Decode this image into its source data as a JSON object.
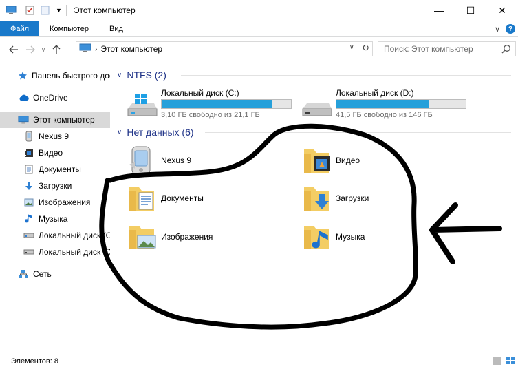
{
  "window": {
    "title": "Этот компьютер",
    "controls": {
      "minimize": "—",
      "maximize": "☐",
      "close": "✕"
    }
  },
  "ribbon": {
    "tabs": [
      "Файл",
      "Компьютер",
      "Вид"
    ],
    "expand": "∨",
    "help": "?"
  },
  "address": {
    "path": "Этот компьютер",
    "search_placeholder": "Поиск: Этот компьютер"
  },
  "sidebar": {
    "items": [
      {
        "label": "Панель быстрого доступа",
        "icon": "star-icon"
      },
      {
        "label": "OneDrive",
        "icon": "cloud-icon"
      },
      {
        "label": "Этот компьютер",
        "icon": "computer-icon"
      },
      {
        "label": "Nexus 9",
        "icon": "phone-icon"
      },
      {
        "label": "Видео",
        "icon": "video-icon"
      },
      {
        "label": "Документы",
        "icon": "documents-icon"
      },
      {
        "label": "Загрузки",
        "icon": "download-icon"
      },
      {
        "label": "Изображения",
        "icon": "pictures-icon"
      },
      {
        "label": "Музыка",
        "icon": "music-icon"
      },
      {
        "label": "Локальный диск (C:)",
        "icon": "drive-icon"
      },
      {
        "label": "Локальный диск (D:)",
        "icon": "drive-icon"
      },
      {
        "label": "Сеть",
        "icon": "network-icon"
      }
    ]
  },
  "groups": {
    "ntfs": {
      "label": "NTFS (2)",
      "drives": [
        {
          "name": "Локальный диск (C:)",
          "free": "3,10 ГБ свободно из 21,1 ГБ",
          "used_fraction": 0.853
        },
        {
          "name": "Локальный диск (D:)",
          "free": "41,5 ГБ свободно из 146 ГБ",
          "used_fraction": 0.716
        }
      ]
    },
    "nodata": {
      "label": "Нет данных (6)",
      "items": [
        {
          "label": "Nexus 9",
          "icon": "phone-icon"
        },
        {
          "label": "Видео",
          "icon": "video-folder-icon"
        },
        {
          "label": "Документы",
          "icon": "documents-folder-icon"
        },
        {
          "label": "Загрузки",
          "icon": "downloads-folder-icon"
        },
        {
          "label": "Изображения",
          "icon": "pictures-folder-icon"
        },
        {
          "label": "Музыка",
          "icon": "music-folder-icon"
        }
      ]
    }
  },
  "status": {
    "count": "Элементов: 8"
  },
  "colors": {
    "accent": "#1979ca",
    "bar_fill": "#26a0da",
    "group_text": "#1e3287",
    "selected_bg": "#d9d9d9"
  }
}
